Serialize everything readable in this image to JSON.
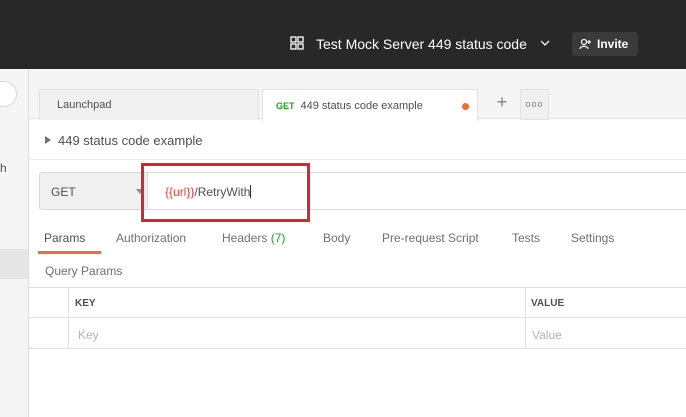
{
  "header": {
    "workspace_title": "Test Mock Server 449 status code",
    "invite_label": "Invite"
  },
  "sidebar": {
    "partial_label": "h"
  },
  "tabs": [
    {
      "label": "Launchpad"
    },
    {
      "method": "GET",
      "label": "449 status code example",
      "unsaved": true
    }
  ],
  "tab_actions": {
    "add_label": "+",
    "more_label": "ooo"
  },
  "request": {
    "name": "449 status code example",
    "method": "GET",
    "url_variable": "{{url}}",
    "url_path": "/RetryWith"
  },
  "request_tabs": [
    {
      "label": "Params",
      "active": true
    },
    {
      "label": "Authorization"
    },
    {
      "label": "Headers",
      "count": "(7)"
    },
    {
      "label": "Body"
    },
    {
      "label": "Pre-request Script"
    },
    {
      "label": "Tests"
    },
    {
      "label": "Settings"
    }
  ],
  "query_params": {
    "title": "Query Params",
    "columns": [
      "KEY",
      "VALUE"
    ],
    "placeholders": [
      "Key",
      "Value"
    ]
  },
  "colors": {
    "accent": "#f26b3a",
    "method_get": "#20a020",
    "variable": "#e0463c",
    "highlight": "#d8262e"
  }
}
